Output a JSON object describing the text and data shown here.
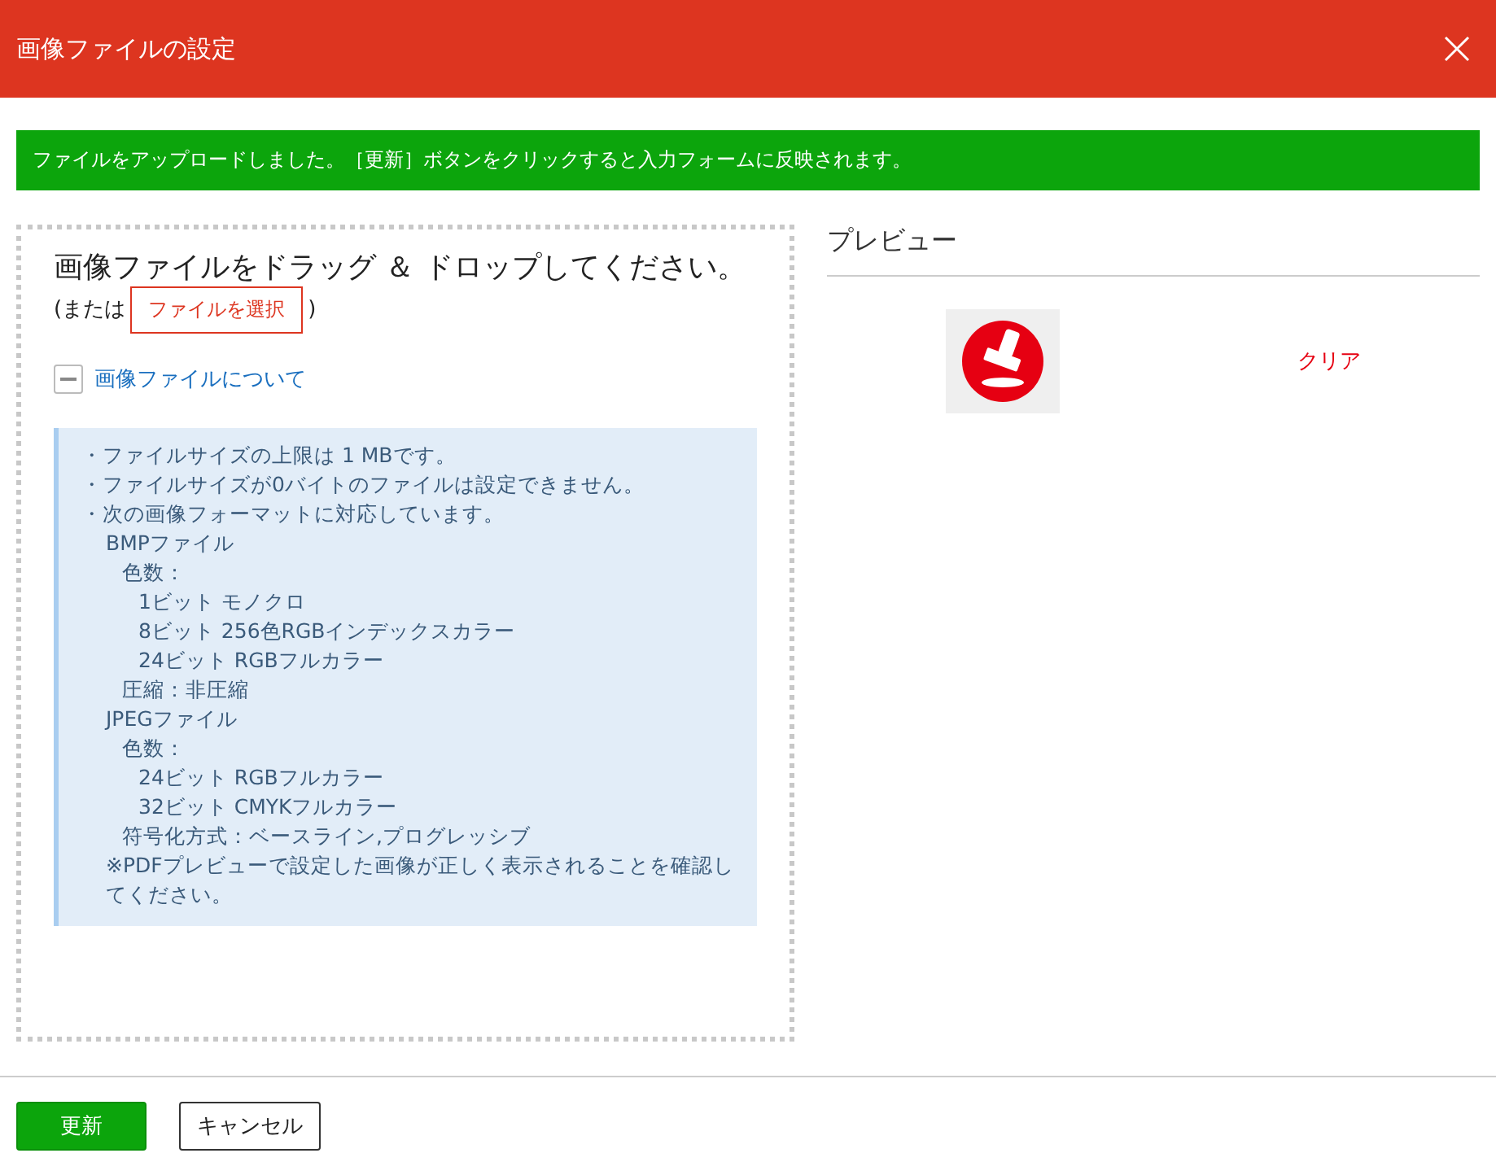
{
  "window": {
    "title": "画像ファイルの設定"
  },
  "notice": "ファイルをアップロードしました。［更新］ボタンをクリックすると入力フォームに反映されます。",
  "dropzone": {
    "heading": "画像ファイルをドラッグ ＆ ドロップしてください。",
    "or_prefix": "(または",
    "select_button": "ファイルを選択",
    "or_suffix": ")"
  },
  "info_toggle": {
    "label": "画像ファイルについて",
    "expanded": true
  },
  "info": [
    {
      "text": "・ファイルサイズの上限は 1 MBです。"
    },
    {
      "text": "・ファイルサイズが0バイトのファイルは設定できません。"
    },
    {
      "text": "・次の画像フォーマットに対応しています。",
      "children": [
        {
          "text": "BMPファイル",
          "children": [
            {
              "text": "色数：",
              "children": [
                {
                  "text": "1ビット モノクロ"
                },
                {
                  "text": "8ビット 256色RGBインデックスカラー"
                },
                {
                  "text": "24ビット RGBフルカラー"
                }
              ]
            },
            {
              "text": "圧縮：非圧縮"
            }
          ]
        },
        {
          "text": "JPEGファイル",
          "children": [
            {
              "text": "色数：",
              "children": [
                {
                  "text": "24ビット RGBフルカラー"
                },
                {
                  "text": "32ビット CMYKフルカラー"
                }
              ]
            },
            {
              "text": "符号化方式：ベースライン,プログレッシブ"
            }
          ]
        },
        {
          "text": "※PDFプレビューで設定した画像が正しく表示されることを確認してください。"
        }
      ]
    }
  ],
  "preview": {
    "heading": "プレビュー",
    "clear_link": "クリア"
  },
  "buttons": [
    {
      "label": "更新",
      "kind": "primary"
    },
    {
      "label": "キャンセル",
      "kind": "secondary"
    }
  ]
}
